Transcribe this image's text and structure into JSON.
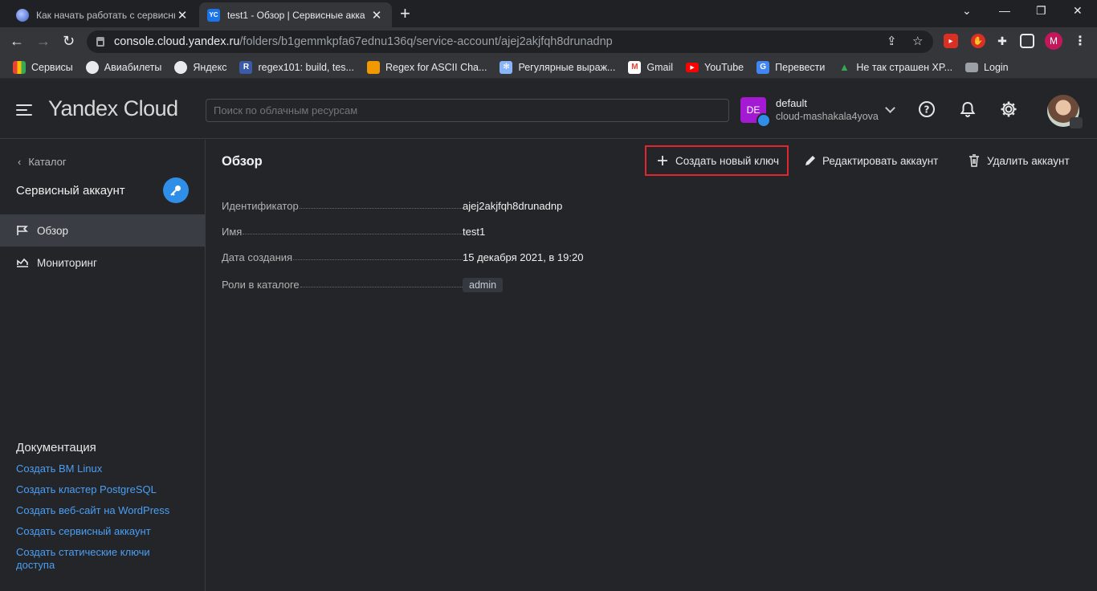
{
  "browser": {
    "tabs": [
      {
        "title": "Как начать работать с сервисны",
        "active": false
      },
      {
        "title": "test1 - Обзор | Сервисные акка",
        "active": true,
        "favicon_text": "YC"
      }
    ],
    "url_host": "console.cloud.yandex.ru",
    "url_path": "/folders/b1gemmkpfa67ednu136q/service-account/ajej2akjfqh8drunadnp",
    "profile_letter": "M",
    "bookmarks": [
      {
        "label": "Сервисы",
        "icon": "apps-grid-icon"
      },
      {
        "label": "Авиабилеты",
        "icon": "globe-icon"
      },
      {
        "label": "Яндекс",
        "icon": "globe-icon"
      },
      {
        "label": "regex101: build, tes...",
        "icon": "regex101-icon",
        "glyph": "R"
      },
      {
        "label": "Regex for ASCII Cha...",
        "icon": "orange-square-icon"
      },
      {
        "label": "Регулярные выраж...",
        "icon": "snowflake-icon"
      },
      {
        "label": "Gmail",
        "icon": "gmail-icon"
      },
      {
        "label": "YouTube",
        "icon": "youtube-icon"
      },
      {
        "label": "Перевести",
        "icon": "translate-icon"
      },
      {
        "label": "Не так страшен XP...",
        "icon": "tree-icon"
      },
      {
        "label": "Login",
        "icon": "mail-icon"
      }
    ]
  },
  "header": {
    "logo": "Yandex Cloud",
    "search_placeholder": "Поиск по облачным ресурсам",
    "cloud_badge": "DE",
    "cloud_name": "default",
    "cloud_sub": "cloud-mashakala4yova"
  },
  "sidebar": {
    "back_label": "Каталог",
    "title": "Сервисный аккаунт",
    "items": [
      {
        "label": "Обзор",
        "active": true
      },
      {
        "label": "Мониторинг",
        "active": false
      }
    ],
    "docs_title": "Документация",
    "docs": [
      "Создать ВМ Linux",
      "Создать кластер PostgreSQL",
      "Создать веб-сайт на WordPress",
      "Создать сервисный аккаунт",
      "Создать статические ключи доступа"
    ]
  },
  "main": {
    "title": "Обзор",
    "create_key": "Создать новый ключ",
    "edit_account": "Редактировать аккаунт",
    "delete_account": "Удалить аккаунт",
    "fields": [
      {
        "label": "Идентификатор",
        "value": "ajej2akjfqh8drunadnp"
      },
      {
        "label": "Имя",
        "value": "test1"
      },
      {
        "label": "Дата создания",
        "value": "15 декабря 2021, в 19:20"
      },
      {
        "label": "Роли в каталоге",
        "value": "admin",
        "tag": true
      }
    ]
  },
  "colors": {
    "accent": "#2f8fe8",
    "highlight": "#e0262e",
    "badge": "#a41ad3"
  }
}
